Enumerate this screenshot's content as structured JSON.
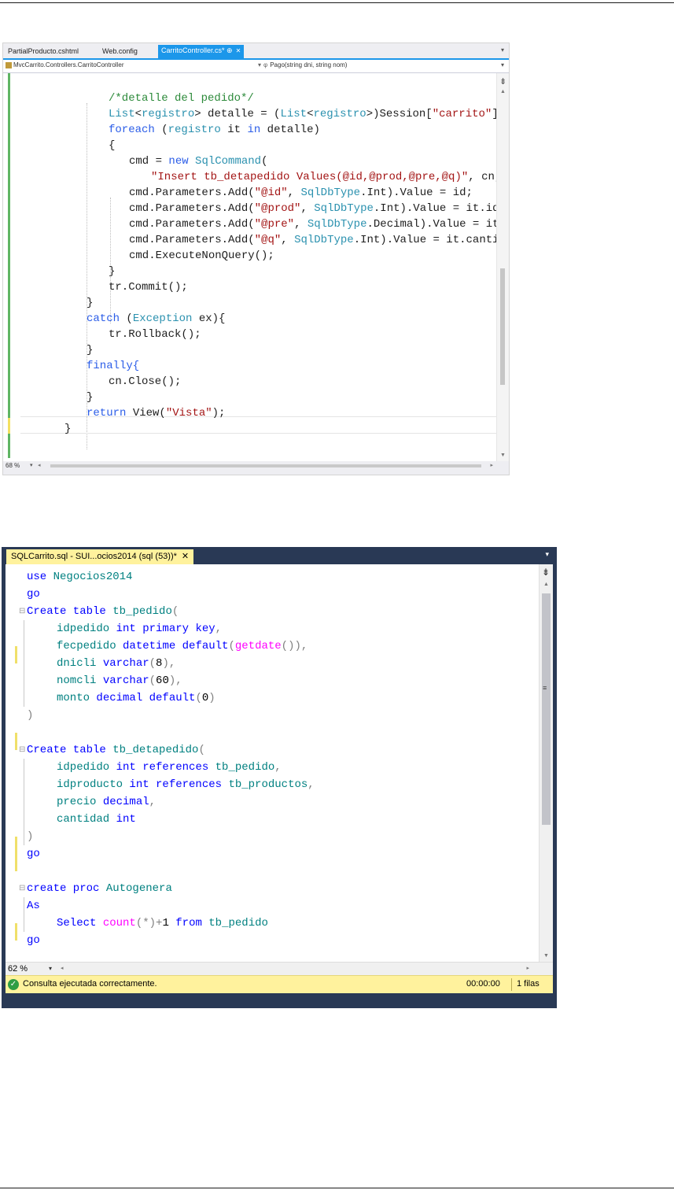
{
  "vs_editor": {
    "tabs": [
      {
        "label": "PartialProducto.cshtml"
      },
      {
        "label": "Web.config"
      },
      {
        "label": "CarritoController.cs*",
        "pin": "⊕",
        "close": "✕"
      }
    ],
    "nav_left": "MvcCarrito.Controllers.CarritoController",
    "nav_right_icon": "φ",
    "nav_right": "Pago(string dni, string nom)",
    "zoom": "68 %",
    "code_lines": [
      "/*detalle del pedido*/",
      "List<registro> detalle = (List<registro>)Session[\"carrito\"];",
      "foreach (registro it in detalle)",
      "{",
      "cmd = new SqlCommand(",
      "\"Insert tb_detapedido Values(@id,@prod,@pre,@q)\", cn, tr);",
      "cmd.Parameters.Add(\"@id\", SqlDbType.Int).Value = id;",
      "cmd.Parameters.Add(\"@prod\", SqlDbType.Int).Value = it.idproducto;",
      "cmd.Parameters.Add(\"@pre\", SqlDbType.Decimal).Value = it.precio;",
      "cmd.Parameters.Add(\"@q\", SqlDbType.Int).Value = it.cantidad;",
      "cmd.ExecuteNonQuery();",
      "}",
      "tr.Commit();",
      "}",
      "catch (Exception ex){",
      "tr.Rollback();",
      "}",
      "finally{",
      "cn.Close();",
      "}",
      "return View(\"Vista\");",
      "}"
    ]
  },
  "ssms_editor": {
    "tab_label": "SQLCarrito.sql - SUI...ocios2014 (sql (53))*",
    "tab_close": "✕",
    "zoom": "62 %",
    "status_message": "Consulta ejecutada correctamente.",
    "status_time": "00:00:00",
    "status_rows": "1 filas",
    "code_lines": [
      "use Negocios2014",
      "go",
      "Create table tb_pedido(",
      "idpedido int primary key,",
      "fecpedido datetime default(getdate()),",
      "dnicli varchar(8),",
      "nomcli varchar(60),",
      "monto decimal default(0)",
      ")",
      "",
      "Create table tb_detapedido(",
      "idpedido int references tb_pedido,",
      "idproducto int references tb_productos,",
      "precio decimal,",
      "cantidad int",
      ")",
      "go",
      "",
      "create proc Autogenera",
      "As",
      "Select count(*)+1 from tb_pedido",
      "go"
    ]
  },
  "colors": {
    "vs_accent": "#1c97ea",
    "ssms_chrome": "#293955",
    "ssms_tab_yellow": "#fff29d",
    "success_green": "#2f9e44"
  }
}
